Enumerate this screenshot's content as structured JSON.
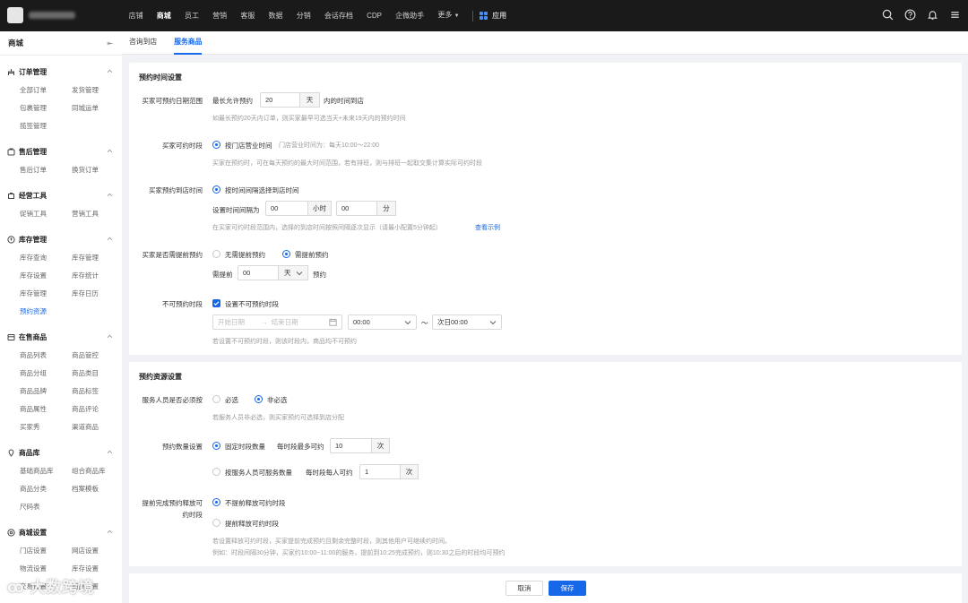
{
  "topbar": {
    "nav": [
      "店铺",
      "商城",
      "员工",
      "营销",
      "客服",
      "数据",
      "分销",
      "会话存档",
      "CDP",
      "企微助手",
      "更多"
    ],
    "active_nav": "商城",
    "app_label": "应用",
    "icons": [
      "search-icon",
      "help-icon",
      "bell-icon",
      "menu-icon"
    ]
  },
  "sidebar": {
    "title": "商城",
    "groups": [
      {
        "label": "订单管理",
        "icon": "order-icon",
        "items": [
          "全部订单",
          "发货管理",
          "包裹管理",
          "同城运单",
          "揽签管理"
        ]
      },
      {
        "label": "售后管理",
        "icon": "aftersale-icon",
        "items": [
          "售后订单",
          "换货订单"
        ]
      },
      {
        "label": "经营工具",
        "icon": "tools-icon",
        "items": [
          "促销工具",
          "营销工具"
        ]
      },
      {
        "label": "库存管理",
        "icon": "inventory-icon",
        "items": [
          "库存查询",
          "库存管理",
          "库存设置",
          "库存统计",
          "库存管理",
          "库存日历",
          "预约资源"
        ]
      },
      {
        "label": "在售商品",
        "icon": "goods-icon",
        "items": [
          "商品列表",
          "商品管控",
          "商品分组",
          "商品类目",
          "商品品牌",
          "商品标签",
          "商品属性",
          "商品评论",
          "买家秀",
          "渠道商品"
        ]
      },
      {
        "label": "商品库",
        "icon": "library-icon",
        "items": [
          "基础商品库",
          "组合商品库",
          "商品分类",
          "档案模板",
          "尺码表"
        ]
      },
      {
        "label": "商城设置",
        "icon": "settings-icon",
        "items": [
          "门店设置",
          "网店设置",
          "物流设置",
          "库存设置",
          "交易设置",
          "商品设置"
        ]
      }
    ],
    "active_item": "预约资源"
  },
  "tabs": [
    "咨询到店",
    "服务商品"
  ],
  "active_tab": "服务商品",
  "booking_time": {
    "title": "预约时间设置",
    "date_range": {
      "label": "买家可预约日期范围",
      "prefix": "最长允许预约",
      "value": "20",
      "unit": "天",
      "suffix": "内的时间到店",
      "hint": "如最长预约20天内订单，则买家最早可选当天+未来19天内的预约时间"
    },
    "period": {
      "label": "买家可约时段",
      "option": "按门店营业时间",
      "store_hours": "门店营业时间为：每天10:00～22:00",
      "hint": "买家在预约时，可在每天预约的最大时间范围，若有排班，则与排班一起取交集计算实际可约时段"
    },
    "arrival": {
      "label": "买家预约到店时间",
      "option": "按时间间隔选择到店时间",
      "interval_label": "设置时间间隔为",
      "hours_value": "00",
      "hours_unit": "小时",
      "minutes_value": "00",
      "minutes_unit": "分",
      "hint": "在买家可约时段范围内，选择的到店时间按照间隔逐次显示（请最小配置5分钟起）",
      "link": "查看示例"
    },
    "advance": {
      "label": "买家是否需提前预约",
      "option_no": "无需提前预约",
      "option_yes": "需提前预约",
      "prefix": "需提前",
      "value": "00",
      "unit": "天",
      "suffix": "预约"
    },
    "unavailable": {
      "label": "不可预约时段",
      "checkbox": "设置不可预约时段",
      "start_placeholder": "开始日期",
      "separator": "→",
      "end_placeholder": "结束日期",
      "start_time": "00:00",
      "tilde": "～",
      "end_time": "次日00:00",
      "hint": "若设置不可预约时段，则该时段内，商品均不可预约"
    }
  },
  "resource": {
    "title": "预约资源设置",
    "staff_required": {
      "label": "服务人员是否必须按",
      "option_required": "必选",
      "option_optional": "非必选",
      "hint": "若服务人员非必选，则买家预约可选择到店分配"
    },
    "quantity": {
      "label": "预约数量设置",
      "fixed_option": "固定时段数量",
      "fixed_prefix": "每时段最多可约",
      "fixed_value": "10",
      "fixed_unit": "次",
      "staff_option": "按服务人员可服务数量",
      "staff_prefix": "每时段每人可约",
      "staff_value": "1",
      "staff_unit": "次"
    },
    "release": {
      "label_line1": "提前完成预约释放可",
      "label_line2": "约时段",
      "option_no": "不提前释放可约时段",
      "option_yes": "提前释放可约时段",
      "hint1": "若设置释放可约时段，买家提前完成预约且剩余完整时段，则其他用户可继续约时间。",
      "hint2": "例如：时段间隔30分钟，买家约10:00~11:00的服务，提前到10:25完成预约，则10:30之后的时段均可预约"
    }
  },
  "footer": {
    "cancel": "取消",
    "save": "保存"
  },
  "watermark": "大数跨境",
  "colors": {
    "accent": "#1768e8",
    "topbar": "#1a1a1a"
  }
}
